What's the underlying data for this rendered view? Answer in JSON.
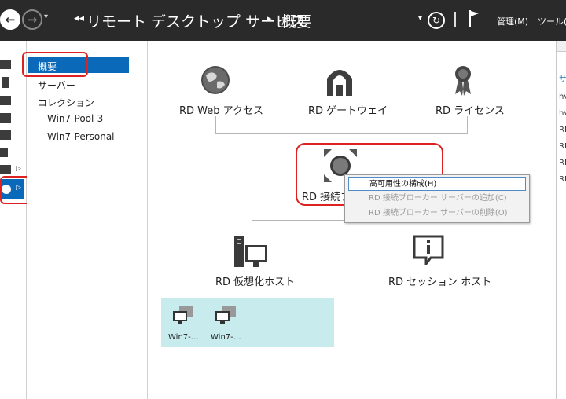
{
  "titlebar": {
    "back_symbol": "←",
    "forward_symbol": "→",
    "dropdown_symbol": "▾",
    "breadcrumb_arrows": "◂◂",
    "breadcrumb_root": "リモート デスクトップ サービス",
    "breadcrumb_sep": "▸",
    "breadcrumb_current": "概要",
    "refresh_symbol": "↻",
    "manage_menu": "管理(M)",
    "tools_menu": "ツール(T"
  },
  "nav": {
    "items": [
      {
        "label": "概要",
        "selected": true
      },
      {
        "label": "サーバー"
      },
      {
        "label": "コレクション"
      },
      {
        "label": "Win7-Pool-3"
      },
      {
        "label": "Win7-Personal"
      }
    ]
  },
  "diagram": {
    "web_access": "RD Web アクセス",
    "gateway": "RD ゲートウェイ",
    "licensing": "RD ライセンス",
    "broker": "RD 接続ブ",
    "virtualization_host": "RD 仮想化ホスト",
    "session_host": "RD セッション ホスト",
    "vms": [
      "Win7-…",
      "Win7-…"
    ]
  },
  "context_menu": {
    "items": [
      {
        "label": "高可用性の構成(H)",
        "enabled": true
      },
      {
        "label": "RD 接続ブローカー サーバーの追加(C)",
        "enabled": false
      },
      {
        "label": "RD 接続ブローカー サーバーの削除(O)",
        "enabled": false
      }
    ]
  },
  "right_pane": {
    "items": [
      "サ",
      "hv",
      "hv",
      "RD",
      "RD",
      "RD",
      "RD"
    ]
  },
  "colors": {
    "titlebar": "#2a2a2a",
    "selection": "#0a69b8",
    "highlight": "#dd2222",
    "vm_area": "#c8ebee"
  }
}
